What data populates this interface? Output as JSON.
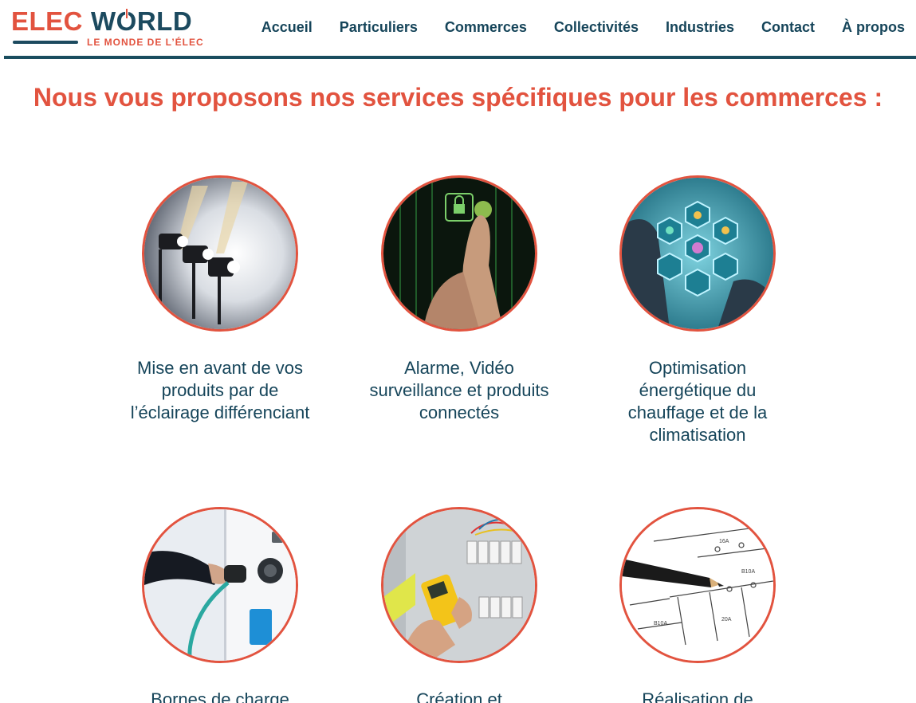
{
  "brand": {
    "name_part1": "ELEC",
    "name_part2": "W",
    "name_part3": "RLD",
    "tagline": "LE MONDE DE L’ÉLEC"
  },
  "nav": [
    "Accueil",
    "Particuliers",
    "Commerces",
    "Collectivités",
    "Industries",
    "Contact",
    "À propos"
  ],
  "section_title": "Nous vous proposons nos services spécifiques pour les commerces :",
  "services": [
    {
      "caption": "Mise en avant de vos produits par de l’éclairage différenciant",
      "image": "spotlights-photo"
    },
    {
      "caption": "Alarme, Vidéo surveillance et produits connectés",
      "image": "security-access-photo"
    },
    {
      "caption": "Optimisation énergétique du chauffage et de la climatisation",
      "image": "energy-icons-photo"
    },
    {
      "caption": "Bornes de charge",
      "image": "ev-charging-photo"
    },
    {
      "caption": "Création et",
      "image": "electrical-panel-photo"
    },
    {
      "caption": "Réalisation de",
      "image": "electrical-schematic-photo"
    }
  ],
  "colors": {
    "accent": "#e2533f",
    "primary": "#16455a",
    "rule": "#1a4d5f"
  }
}
